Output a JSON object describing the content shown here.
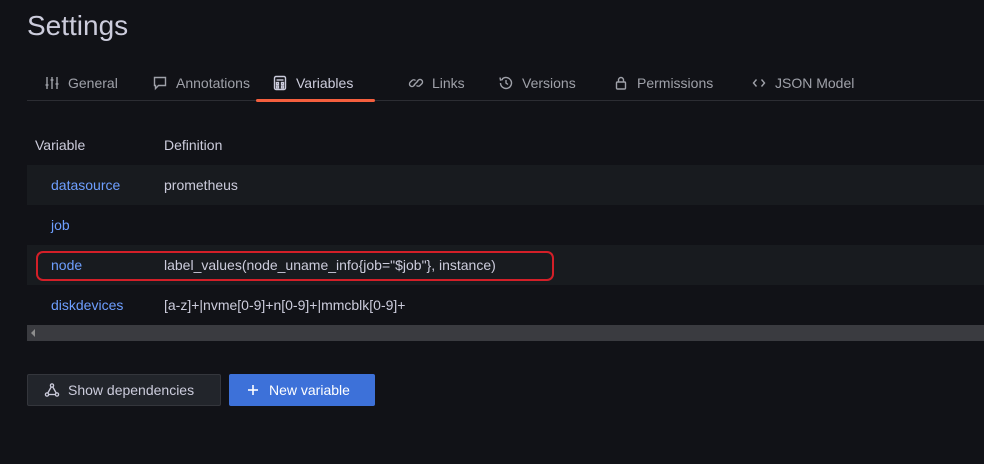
{
  "page": {
    "title": "Settings"
  },
  "tabs": [
    {
      "label": "General",
      "icon": "sliders-icon"
    },
    {
      "label": "Annotations",
      "icon": "comment-icon"
    },
    {
      "label": "Variables",
      "icon": "calculator-icon",
      "active": true
    },
    {
      "label": "Links",
      "icon": "link-icon"
    },
    {
      "label": "Versions",
      "icon": "history-icon"
    },
    {
      "label": "Permissions",
      "icon": "lock-icon"
    },
    {
      "label": "JSON Model",
      "icon": "code-icon"
    }
  ],
  "table": {
    "headers": {
      "variable": "Variable",
      "definition": "Definition"
    },
    "rows": [
      {
        "variable": "datasource",
        "definition": "prometheus"
      },
      {
        "variable": "job",
        "definition": ""
      },
      {
        "variable": "node",
        "definition": "label_values(node_uname_info{job=\"$job\"}, instance)",
        "highlighted": true
      },
      {
        "variable": "diskdevices",
        "definition": "[a-z]+|nvme[0-9]+n[0-9]+|mmcblk[0-9]+"
      }
    ]
  },
  "buttons": {
    "show_dependencies": "Show dependencies",
    "new_variable": "New variable"
  },
  "colors": {
    "accent_tab": "#f55f3e",
    "link": "#6e9fff",
    "primary_button": "#3d71d9",
    "highlight_box": "#d31f28"
  }
}
